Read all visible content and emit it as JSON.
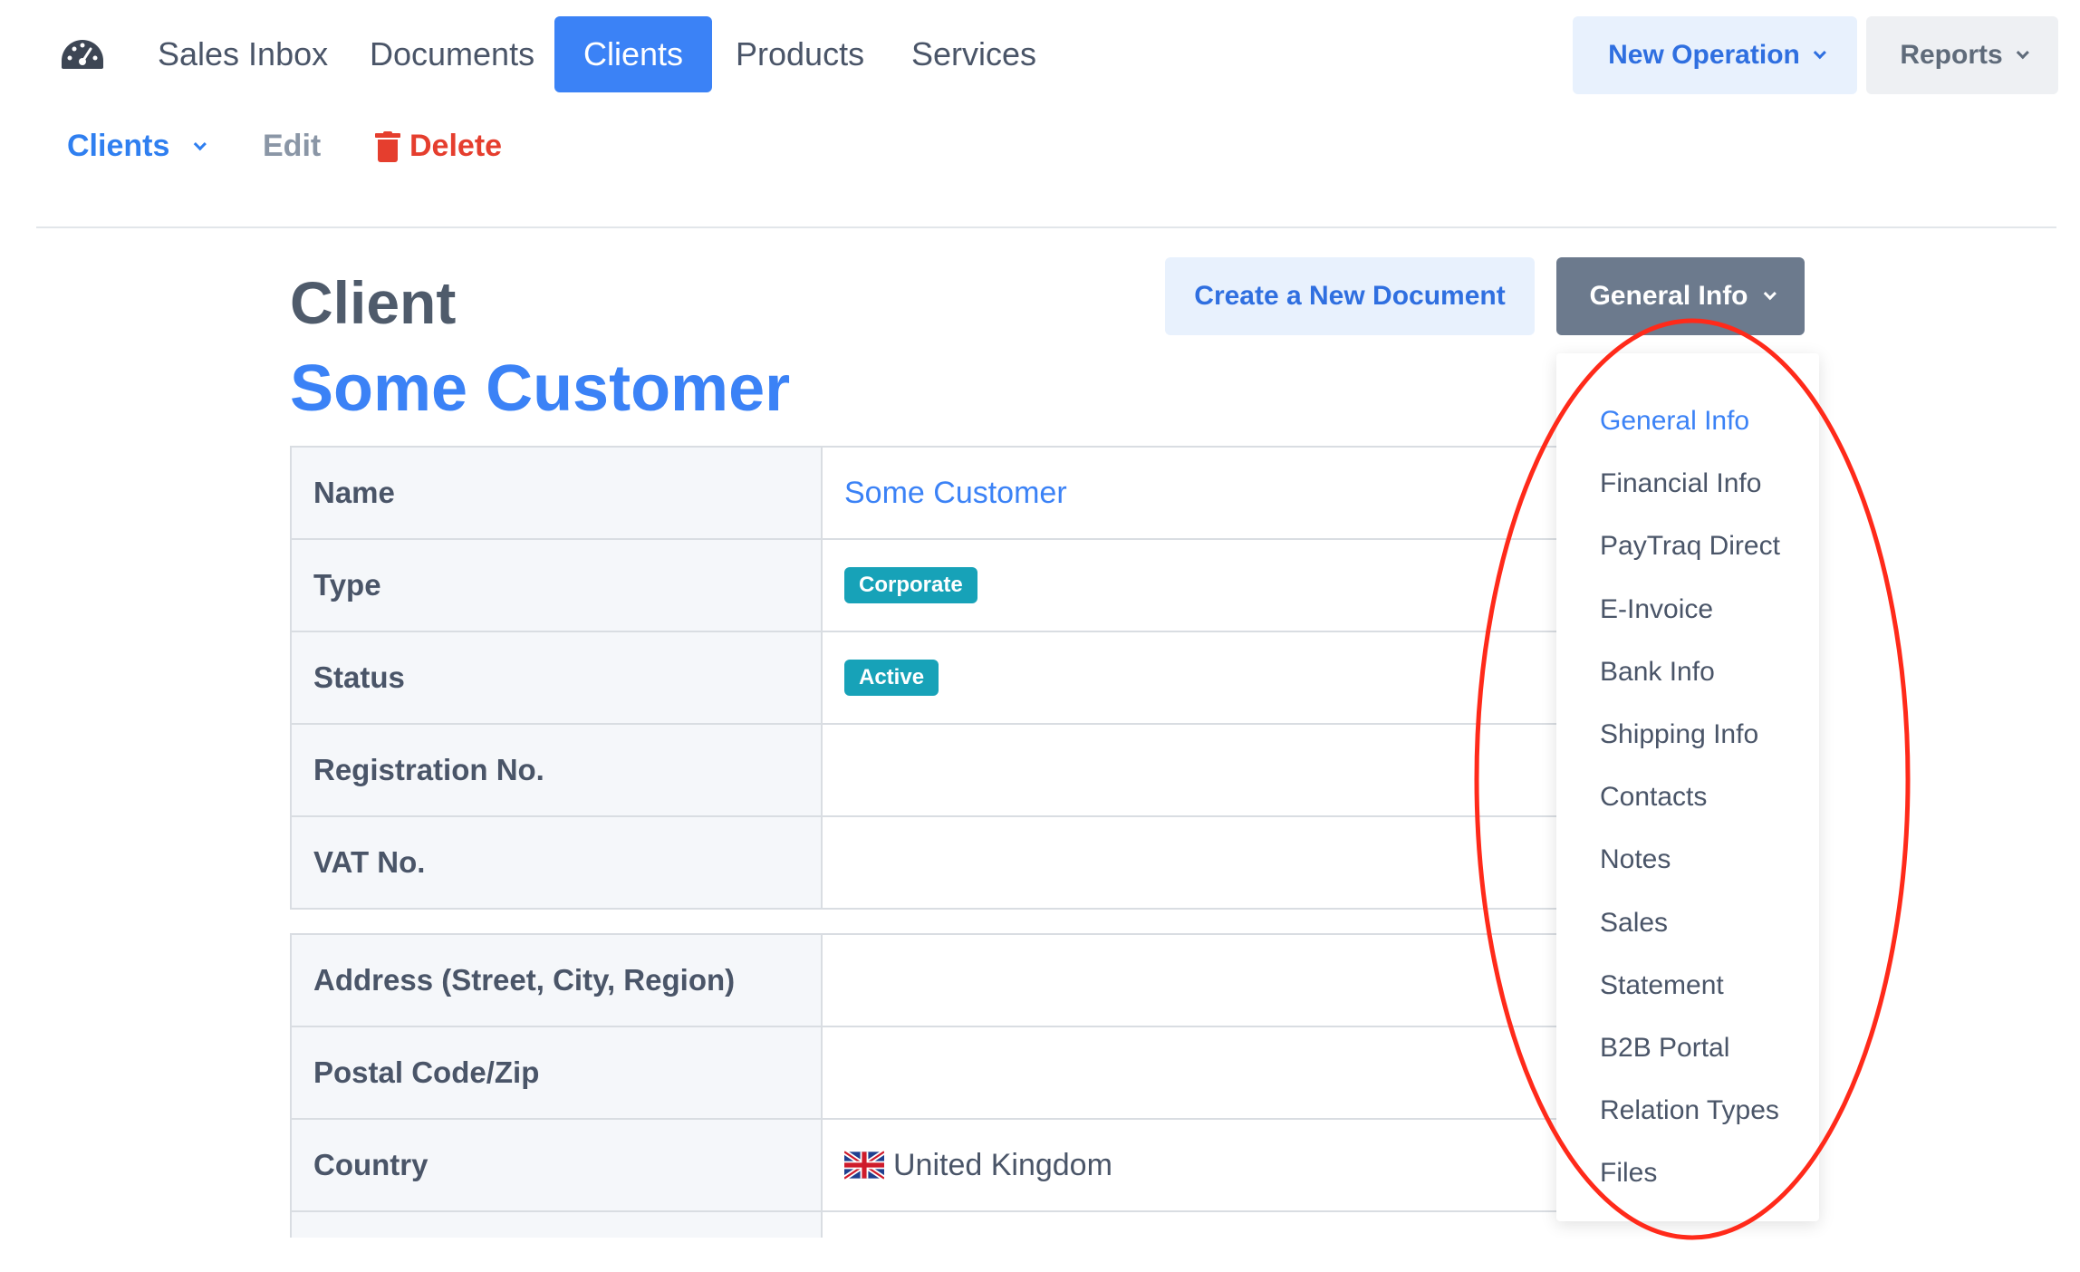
{
  "nav": {
    "items": [
      {
        "label": "Sales Inbox"
      },
      {
        "label": "Documents"
      },
      {
        "label": "Clients"
      },
      {
        "label": "Products"
      },
      {
        "label": "Services"
      }
    ],
    "new_operation_label": "New Operation",
    "reports_label": "Reports"
  },
  "subnav": {
    "clients_label": "Clients",
    "edit_label": "Edit",
    "delete_label": "Delete"
  },
  "header": {
    "title": "Client",
    "client_name": "Some Customer",
    "create_document_label": "Create a New Document",
    "general_info_label": "General Info"
  },
  "details": [
    {
      "label": "Name",
      "value": "Some Customer"
    },
    {
      "label": "Type",
      "value": "Corporate"
    },
    {
      "label": "Status",
      "value": "Active"
    },
    {
      "label": "Registration No.",
      "value": ""
    },
    {
      "label": "VAT No.",
      "value": ""
    }
  ],
  "address": [
    {
      "label": "Address (Street, City, Region)",
      "value": ""
    },
    {
      "label": "Postal Code/Zip",
      "value": ""
    },
    {
      "label": "Country",
      "value": "United Kingdom"
    }
  ],
  "dropdown": {
    "items": [
      {
        "label": "General Info"
      },
      {
        "label": "Financial Info"
      },
      {
        "label": "PayTraq Direct"
      },
      {
        "label": "E-Invoice"
      },
      {
        "label": "Bank Info"
      },
      {
        "label": "Shipping Info"
      },
      {
        "label": "Contacts"
      },
      {
        "label": "Notes"
      },
      {
        "label": "Sales"
      },
      {
        "label": "Statement"
      },
      {
        "label": "B2B Portal"
      },
      {
        "label": "Relation Types"
      },
      {
        "label": "Files"
      }
    ]
  },
  "colors": {
    "accent": "#3b82f6",
    "badge": "#17a2b8",
    "danger": "#e53e2e",
    "annotation": "#ff2a1a"
  }
}
